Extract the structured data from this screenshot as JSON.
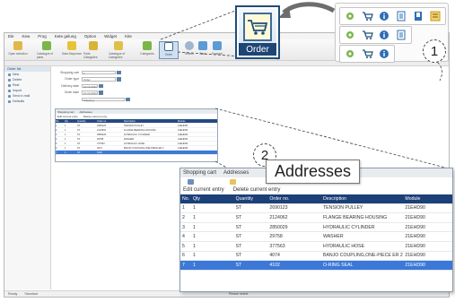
{
  "app": {
    "menu": [
      "Ele",
      "Kew",
      "Prog",
      "Kete gelung",
      "Option",
      "Widget",
      "Kite"
    ],
    "toolbar": [
      {
        "label": "Open selection",
        "icon": "open-icon"
      },
      {
        "label": "Catalogue of parts",
        "icon": "catalogue-icon"
      },
      {
        "label": "Data Sequence",
        "icon": "sequence-icon"
      },
      {
        "label": "Parts Categories",
        "icon": "categories-icon"
      },
      {
        "label": "Catalogue of Categories",
        "icon": "catalogue-categories-icon"
      },
      {
        "label": "Categories",
        "icon": "categories-icon"
      },
      {
        "label": "Order",
        "icon": "shopping-cart-icon"
      },
      {
        "label": "Search",
        "icon": "search-icon"
      },
      {
        "label": "Back",
        "icon": "back-icon"
      },
      {
        "label": "Forward",
        "icon": "forward-icon"
      }
    ],
    "sidebar": {
      "header": "Order list",
      "items": [
        "New",
        "Delete",
        "Rest",
        "Import",
        "Send e-mail",
        "Defaults"
      ]
    },
    "form": {
      "rows": [
        {
          "label": "Shopping cart",
          "value": "1"
        },
        {
          "label": "Order type",
          "value": "Order"
        },
        {
          "label": "Delivery date",
          "value": "10.10.2011"
        },
        {
          "label": "Order date",
          "value": "10.10.2011"
        },
        {
          "label": "",
          "value": "Shipping"
        }
      ]
    },
    "small_cart": {
      "tabs": [
        "Shopping cart",
        "Addresses"
      ],
      "actions": [
        "Edit current entry",
        "Delete current entry"
      ],
      "columns": [
        "No.",
        "Qty",
        "Quantity",
        "Order no.",
        "Description",
        "Module"
      ],
      "rows": [
        [
          "1",
          "1",
          "ST",
          "2690123",
          "TENSION PULLEY",
          "21EHD90"
        ],
        [
          "2",
          "1",
          "ST",
          "2124062",
          "FLANGE BEARING HOUSING",
          "21EHD90"
        ],
        [
          "3",
          "1",
          "ST",
          "2850029",
          "HYDRAULIC CYLINDER",
          "21EHD90"
        ],
        [
          "4",
          "1",
          "ST",
          "29758",
          "WASHER",
          "21EHD90"
        ],
        [
          "5",
          "1",
          "ST",
          "377563",
          "HYDRAULIC HOSE",
          "21EHD90"
        ],
        [
          "6",
          "1",
          "ST",
          "4074",
          "BANJO COUPLING,ONE-PIECE ER 2",
          "21EHD90"
        ],
        [
          "7",
          "1",
          "ST",
          "4102",
          "",
          ""
        ]
      ]
    },
    "status": {
      "left": "Ready",
      "mode": "Standard",
      "middle": "Please select"
    }
  },
  "callouts": {
    "order_label": "Order",
    "addresses_label": "Addresses",
    "number_1": "1",
    "number_2": "2"
  },
  "zoom_table": {
    "tabs": [
      "Shopping cart",
      "Addresses"
    ],
    "actions": [
      "Edit current entry",
      "Delete current entry"
    ],
    "columns": [
      "No.",
      "Qty",
      "Quantity",
      "Order no.",
      "Description",
      "Module"
    ],
    "rows": [
      [
        "1",
        "1",
        "ST",
        "2690123",
        "TENSION PULLEY",
        "21EHD90"
      ],
      [
        "2",
        "1",
        "ST",
        "2124062",
        "FLANGE BEARING HOUSING",
        "21EHD90"
      ],
      [
        "3",
        "1",
        "ST",
        "2850029",
        "HYDRAULIC CYLINDER",
        "21EHD90"
      ],
      [
        "4",
        "1",
        "ST",
        "29758",
        "WASHER",
        "21EHD90"
      ],
      [
        "5",
        "1",
        "ST",
        "377563",
        "HYDRAULIC HOSE",
        "21EHD90"
      ],
      [
        "6",
        "1",
        "ST",
        "4074",
        "BANJO COUPLING,ONE-PIECE ER 2",
        "21EHD90"
      ],
      [
        "7",
        "1",
        "ST",
        "4102",
        "O-RING SEAL",
        "21EHD90"
      ]
    ]
  },
  "colors": {
    "header_blue": "#1c4078",
    "selection_blue": "#3b78d8",
    "cart_yellow": "#fff9d8",
    "accent_green": "#7ab648"
  }
}
